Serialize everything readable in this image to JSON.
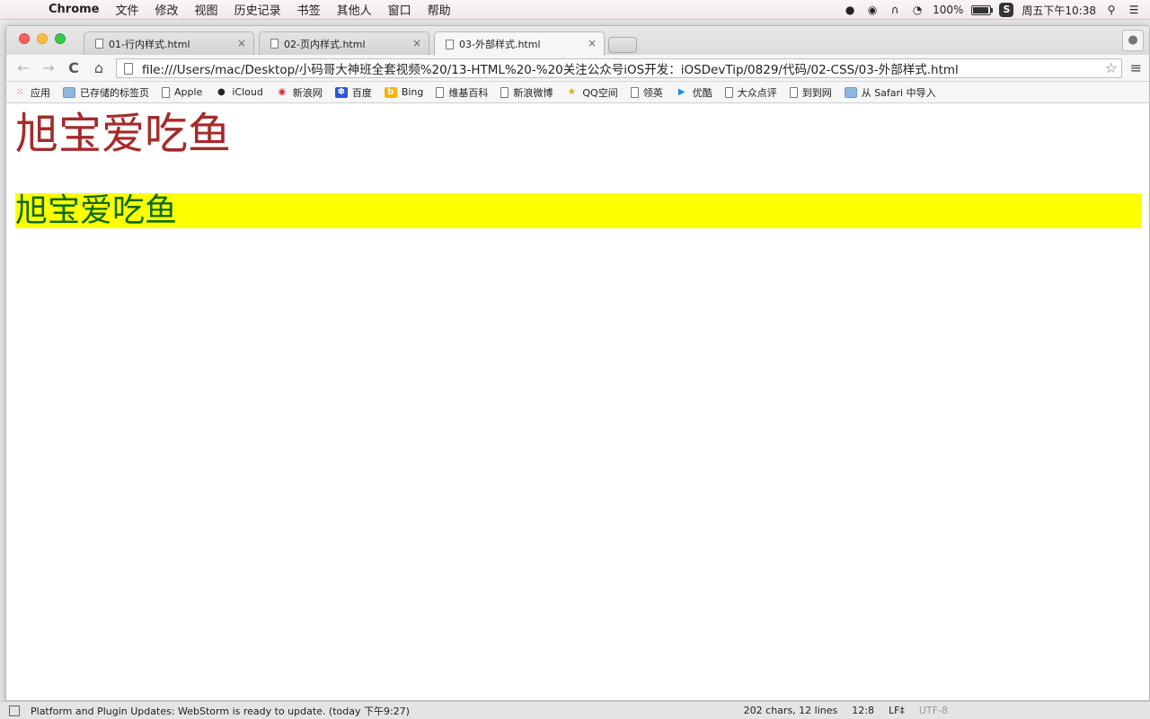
{
  "menubar": {
    "apple": "",
    "app_name": "Chrome",
    "items": [
      "文件",
      "修改",
      "视图",
      "历史记录",
      "书签",
      "其他人",
      "窗口",
      "帮助"
    ],
    "battery": "100%",
    "clock": "周五下午10:38",
    "s_badge": "S"
  },
  "tabs": [
    {
      "title": "01-行内样式.html",
      "close": "×"
    },
    {
      "title": "02-页内样式.html",
      "close": "×"
    },
    {
      "title": "03-外部样式.html",
      "close": "×"
    }
  ],
  "toolbar": {
    "back": "←",
    "forward": "→",
    "reload": "C",
    "home": "⌂",
    "url": "file:///Users/mac/Desktop/小码哥大神班全套视频%20/13-HTML%20-%20关注公众号iOS开发：iOSDevTip/0829/代码/02-CSS/03-外部样式.html",
    "star": "☆",
    "menu": "≡"
  },
  "bookmarks": [
    {
      "label": "应用",
      "icon": "apps-grid-icon"
    },
    {
      "label": "已存储的标签页",
      "icon": "folder-icon"
    },
    {
      "label": "Apple",
      "icon": "document-icon"
    },
    {
      "label": "iCloud",
      "icon": "apple-icon"
    },
    {
      "label": "新浪网",
      "icon": "weibo-icon"
    },
    {
      "label": "百度",
      "icon": "baidu-paw-icon"
    },
    {
      "label": "Bing",
      "icon": "bing-icon"
    },
    {
      "label": "维基百科",
      "icon": "document-icon"
    },
    {
      "label": "新浪微博",
      "icon": "document-icon"
    },
    {
      "label": "QQ空间",
      "icon": "star-icon"
    },
    {
      "label": "领英",
      "icon": "document-icon"
    },
    {
      "label": "优酷",
      "icon": "youku-icon"
    },
    {
      "label": "大众点评",
      "icon": "document-icon"
    },
    {
      "label": "到到网",
      "icon": "document-icon"
    },
    {
      "label": "从 Safari 中导入",
      "icon": "folder-icon"
    }
  ],
  "content": {
    "heading1": "旭宝爱吃鱼",
    "heading2": "旭宝爱吃鱼"
  },
  "colors": {
    "heading1_color": "#a52a2a",
    "heading2_color": "#0d6b0d",
    "heading2_bg": "#ffff00"
  },
  "statusbar": {
    "message": "Platform and Plugin Updates: WebStorm is ready to update. (today 下午9:27)",
    "chars": "202 chars, 12 lines",
    "position": "12:8",
    "line_sep": "LF‡",
    "encoding": "UTF-8"
  }
}
